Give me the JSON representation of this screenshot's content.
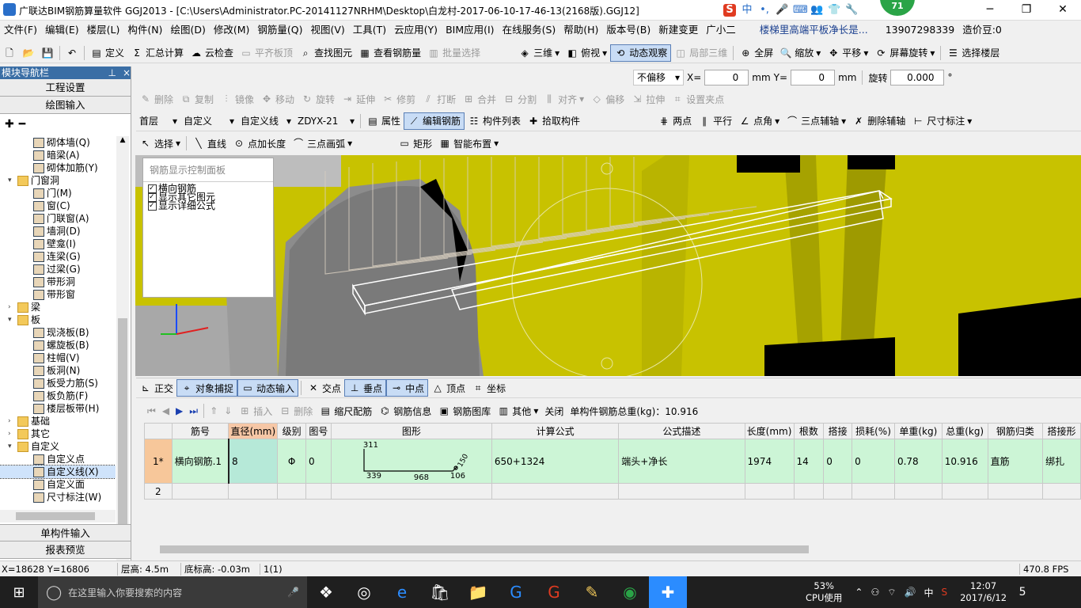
{
  "window": {
    "title": "广联达BIM钢筋算量软件 GGJ2013 - [C:\\Users\\Administrator.PC-20141127NRHM\\Desktop\\白龙村-2017-06-10-17-46-13(2168版).GGJ12]",
    "badge": "71",
    "minimize": "─",
    "restore": "❐",
    "close": "✕"
  },
  "ime": {
    "s": "S",
    "zh": "中",
    "dot": "•,"
  },
  "menu": [
    "文件(F)",
    "编辑(E)",
    "楼层(L)",
    "构件(N)",
    "绘图(D)",
    "修改(M)",
    "钢筋量(Q)",
    "视图(V)",
    "工具(T)",
    "云应用(Y)",
    "BIM应用(I)",
    "在线服务(S)",
    "帮助(H)",
    "版本号(B)",
    "新建变更",
    "广小二",
    "楼梯里高端平板净长是...",
    "13907298339",
    "造价豆:0"
  ],
  "toolbar1": {
    "define": "定义",
    "sum": "汇总计算",
    "cloud": "云检查",
    "flat": "平齐板顶",
    "find": "查找图元",
    "view_qty": "查看钢筋量",
    "batch": "批量选择",
    "three_d": "三维",
    "top_view": "俯视",
    "dynamic": "动态观察",
    "local3d": "局部三维",
    "fullscreen": "全屏",
    "zoom": "缩放",
    "pan": "平移",
    "rotate": "屏幕旋转",
    "select_floor": "选择楼层"
  },
  "toolbar_offset": {
    "mode": "不偏移",
    "x_label": "X=",
    "x_val": "0",
    "y_label": "Y=",
    "y_val": "0",
    "unit": "mm",
    "rotate_label": "旋转",
    "rotate_val": "0.000",
    "deg": "°"
  },
  "toolbar2": [
    "删除",
    "复制",
    "镜像",
    "移动",
    "旋转",
    "延伸",
    "修剪",
    "打断",
    "合并",
    "分割",
    "对齐",
    "偏移",
    "拉伸",
    "设置夹点"
  ],
  "toolbar3": {
    "floor": "首层",
    "type": "自定义",
    "sub": "自定义线",
    "name": "ZDYX-21",
    "props": "属性",
    "edit_rebar": "编辑钢筋",
    "list": "构件列表",
    "pick": "拾取构件",
    "two_pt": "两点",
    "parallel": "平行",
    "angle": "点角",
    "three_aux": "三点辅轴",
    "del_aux": "删除辅轴",
    "dim": "尺寸标注"
  },
  "toolbar4": {
    "select": "选择",
    "line": "直线",
    "point_len": "点加长度",
    "arc": "三点画弧",
    "rect": "矩形",
    "smart": "智能布置"
  },
  "left_panel": {
    "title": "模块导航栏",
    "pin": "📌",
    "close": "×",
    "proj_settings": "工程设置",
    "draw_input": "绘图输入",
    "single_input": "单构件输入",
    "report": "报表预览",
    "tree": [
      {
        "label": "砌体墙(Q)",
        "indent": 3,
        "folder": false
      },
      {
        "label": "暗梁(A)",
        "indent": 3,
        "folder": false
      },
      {
        "label": "砌体加筋(Y)",
        "indent": 3,
        "folder": false
      },
      {
        "label": "门窗洞",
        "indent": 1,
        "folder": true,
        "open": true
      },
      {
        "label": "门(M)",
        "indent": 3,
        "folder": false
      },
      {
        "label": "窗(C)",
        "indent": 3,
        "folder": false
      },
      {
        "label": "门联窗(A)",
        "indent": 3,
        "folder": false
      },
      {
        "label": "墙洞(D)",
        "indent": 3,
        "folder": false
      },
      {
        "label": "壁龛(I)",
        "indent": 3,
        "folder": false
      },
      {
        "label": "连梁(G)",
        "indent": 3,
        "folder": false
      },
      {
        "label": "过梁(G)",
        "indent": 3,
        "folder": false
      },
      {
        "label": "带形洞",
        "indent": 3,
        "folder": false
      },
      {
        "label": "带形窗",
        "indent": 3,
        "folder": false
      },
      {
        "label": "梁",
        "indent": 1,
        "folder": true,
        "open": false
      },
      {
        "label": "板",
        "indent": 1,
        "folder": true,
        "open": true
      },
      {
        "label": "现浇板(B)",
        "indent": 3,
        "folder": false
      },
      {
        "label": "螺旋板(B)",
        "indent": 3,
        "folder": false
      },
      {
        "label": "柱帽(V)",
        "indent": 3,
        "folder": false
      },
      {
        "label": "板洞(N)",
        "indent": 3,
        "folder": false
      },
      {
        "label": "板受力筋(S)",
        "indent": 3,
        "folder": false
      },
      {
        "label": "板负筋(F)",
        "indent": 3,
        "folder": false
      },
      {
        "label": "楼层板带(H)",
        "indent": 3,
        "folder": false
      },
      {
        "label": "基础",
        "indent": 1,
        "folder": true,
        "open": false
      },
      {
        "label": "其它",
        "indent": 1,
        "folder": true,
        "open": false
      },
      {
        "label": "自定义",
        "indent": 1,
        "folder": true,
        "open": true
      },
      {
        "label": "自定义点",
        "indent": 3,
        "folder": false
      },
      {
        "label": "自定义线(X)",
        "indent": 3,
        "folder": false,
        "selected": true
      },
      {
        "label": "自定义面",
        "indent": 3,
        "folder": false
      },
      {
        "label": "尺寸标注(W)",
        "indent": 3,
        "folder": false
      }
    ]
  },
  "ctrl_panel": {
    "title": "钢筋显示控制面板",
    "items": [
      "横向钢筋",
      "显示其它图元",
      "显示详细公式"
    ]
  },
  "snapbar": {
    "ortho": "正交",
    "snap": "对象捕捉",
    "dyn_input": "动态输入",
    "intersect": "交点",
    "perp": "垂点",
    "mid": "中点",
    "vertex": "顶点",
    "coord": "坐标"
  },
  "gridbar": {
    "insert": "插入",
    "delete": "删除",
    "scale": "缩尺配筋",
    "info": "钢筋信息",
    "lib": "钢筋图库",
    "other": "其他",
    "close": "关闭",
    "total": "单构件钢筋总重(kg)：10.916"
  },
  "grid": {
    "headers": [
      "",
      "筋号",
      "直径(mm)",
      "级别",
      "图号",
      "图形",
      "计算公式",
      "公式描述",
      "长度(mm)",
      "根数",
      "搭接",
      "损耗(%)",
      "单重(kg)",
      "总重(kg)",
      "钢筋归类",
      "搭接形"
    ],
    "rows": [
      [
        "1*",
        "横向钢筋.1",
        "8",
        "Φ",
        "0",
        "",
        "650+1324",
        "端头+净长",
        "1974",
        "14",
        "0",
        "0",
        "0.78",
        "10.916",
        "直筋",
        "绑扎"
      ],
      [
        "2",
        "",
        "",
        "",
        "",
        "",
        "",
        "",
        "",
        "",
        "",
        "",
        "",
        "",
        "",
        ""
      ]
    ],
    "shape": {
      "a": "311",
      "b": "339",
      "c": "968",
      "d": "106",
      "e": "150"
    }
  },
  "status": {
    "coord": "X=18628 Y=16806",
    "floor_h": "层高: 4.5m",
    "base_h": "底标高: -0.03m",
    "count": "1(1)",
    "fps": "470.8 FPS"
  },
  "taskbar": {
    "search": "在这里输入你要搜索的内容",
    "cpu": "53%",
    "cpu_label": "CPU使用",
    "time": "12:07",
    "date": "2017/6/12",
    "lang": "中",
    "notif": "5"
  }
}
